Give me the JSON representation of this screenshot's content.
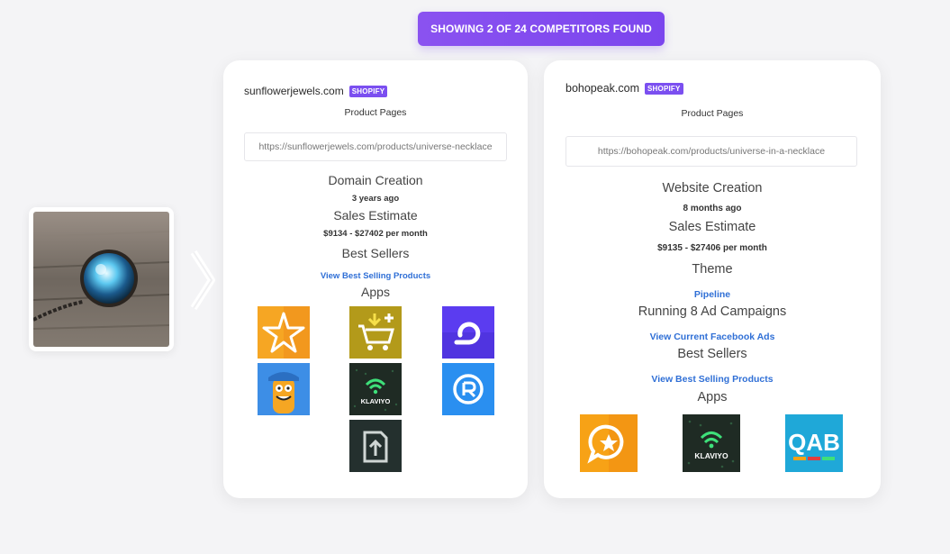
{
  "banner": {
    "text": "SHOWING 2 OF 24 COMPETITORS FOUND"
  },
  "competitors": [
    {
      "domain": "sunflowerjewels.com",
      "platform_badge": "SHOPIFY",
      "product_pages_label": "Product Pages",
      "product_url": "https://sunflowerjewels.com/products/universe-necklace",
      "creation_label": "Domain Creation",
      "creation_value": "3 years ago",
      "sales_label": "Sales Estimate",
      "sales_value": "$9134 - $27402 per month",
      "best_sellers_label": "Best Sellers",
      "best_sellers_link": "View Best Selling Products",
      "apps_label": "Apps",
      "apps": [
        {
          "icon": "star-app-icon",
          "color": "#f6a623"
        },
        {
          "icon": "cart-upsell-app-icon",
          "color": "#b39a1a"
        },
        {
          "icon": "arrow-loop-app-icon",
          "color": "#5b3cf0"
        },
        {
          "icon": "mascot-app-icon",
          "color": "#3d8ee6"
        },
        {
          "icon": "klaviyo-app-icon",
          "color": "#1f2b24",
          "text": "KLAVIYO"
        },
        {
          "icon": "refresh-circle-app-icon",
          "color": "#2a8ff0"
        },
        {
          "icon": "upload-document-app-icon",
          "color": "#24302e"
        }
      ]
    },
    {
      "domain": "bohopeak.com",
      "platform_badge": "SHOPIFY",
      "product_pages_label": "Product Pages",
      "product_url": "https://bohopeak.com/products/universe-in-a-necklace",
      "creation_label": "Website Creation",
      "creation_value": "8 months ago",
      "sales_label": "Sales Estimate",
      "sales_value": "$9135 - $27406 per month",
      "theme_label": "Theme",
      "theme_link": "Pipeline",
      "ads_label": "Running 8 Ad Campaigns",
      "ads_link": "View Current Facebook Ads",
      "best_sellers_label": "Best Sellers",
      "best_sellers_link": "View Best Selling Products",
      "apps_label": "Apps",
      "apps": [
        {
          "icon": "review-star-bubble-app-icon",
          "color": "#f7a216"
        },
        {
          "icon": "klaviyo-app-icon",
          "color": "#1f2b24",
          "text": "KLAVIYO"
        },
        {
          "icon": "qab-app-icon",
          "color": "#1fa8d8",
          "text": "QAB"
        }
      ]
    }
  ]
}
